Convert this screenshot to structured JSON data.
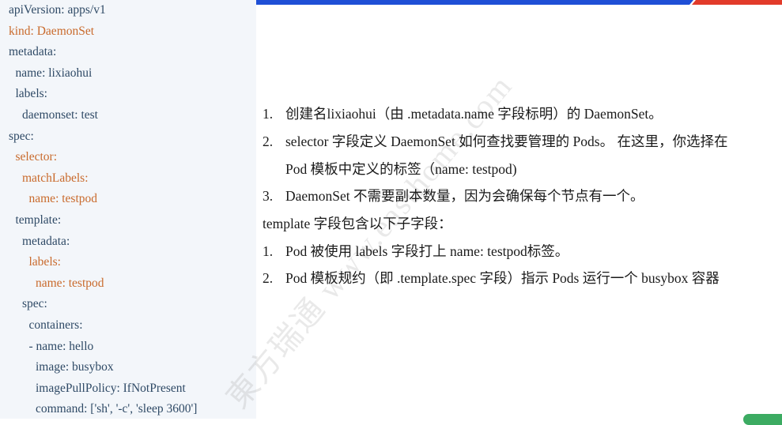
{
  "yaml": [
    {
      "text": "apiVersion: apps/v1",
      "indent": 0,
      "color": "#2f4a66"
    },
    {
      "text": "kind: DaemonSet",
      "indent": 0,
      "color": "#c96a2c"
    },
    {
      "text": "metadata:",
      "indent": 0,
      "color": "#2f4a66"
    },
    {
      "text": "name: lixiaohui",
      "indent": 1,
      "color": "#2f4a66"
    },
    {
      "text": "labels:",
      "indent": 1,
      "color": "#2f4a66"
    },
    {
      "text": "daemonset: test",
      "indent": 2,
      "color": "#2f4a66"
    },
    {
      "text": "spec:",
      "indent": 0,
      "color": "#2f4a66"
    },
    {
      "text": "selector:",
      "indent": 1,
      "color": "#c96a2c"
    },
    {
      "text": "matchLabels:",
      "indent": 2,
      "color": "#c96a2c"
    },
    {
      "text": "name: testpod",
      "indent": 3,
      "color": "#c96a2c"
    },
    {
      "text": "template:",
      "indent": 1,
      "color": "#2f4a66"
    },
    {
      "text": "metadata:",
      "indent": 2,
      "color": "#2f4a66"
    },
    {
      "text": "labels:",
      "indent": 3,
      "color": "#c96a2c"
    },
    {
      "text": "name: testpod",
      "indent": 4,
      "color": "#c96a2c"
    },
    {
      "text": "spec:",
      "indent": 2,
      "color": "#2f4a66"
    },
    {
      "text": "containers:",
      "indent": 3,
      "color": "#2f4a66"
    },
    {
      "text": "- name: hello",
      "indent": 3,
      "color": "#2f4a66"
    },
    {
      "text": "image: busybox",
      "indent": 4,
      "color": "#2f4a66"
    },
    {
      "text": "imagePullPolicy: IfNotPresent",
      "indent": 4,
      "color": "#2f4a66"
    },
    {
      "text": "command: ['sh', '-c', 'sleep 3600']",
      "indent": 4,
      "color": "#2f4a66"
    }
  ],
  "explain": {
    "item1_num": "1.",
    "item1": "创建名lixiaohui（由 .metadata.name 字段标明）的 DaemonSet。",
    "item2_num": "2.",
    "item2_line1": "selector 字段定义 DaemonSet 如何查找要管理的 Pods。 在这里，你选择在",
    "item2_line2": "Pod 模板中定义的标签（name: testpod)",
    "item3_num": "3.",
    "item3": "DaemonSet 不需要副本数量，因为会确保每个节点有一个。",
    "template_intro": "template 字段包含以下子字段：",
    "sub1_num": "1.",
    "sub1": "Pod 被使用 labels 字段打上 name: testpod标签。",
    "sub2_num": "2.",
    "sub2": "Pod 模板规约（即 .template.spec 字段）指示 Pods 运行一个 busybox 容器"
  },
  "watermark": "東方瑞通 www.easthome.com"
}
